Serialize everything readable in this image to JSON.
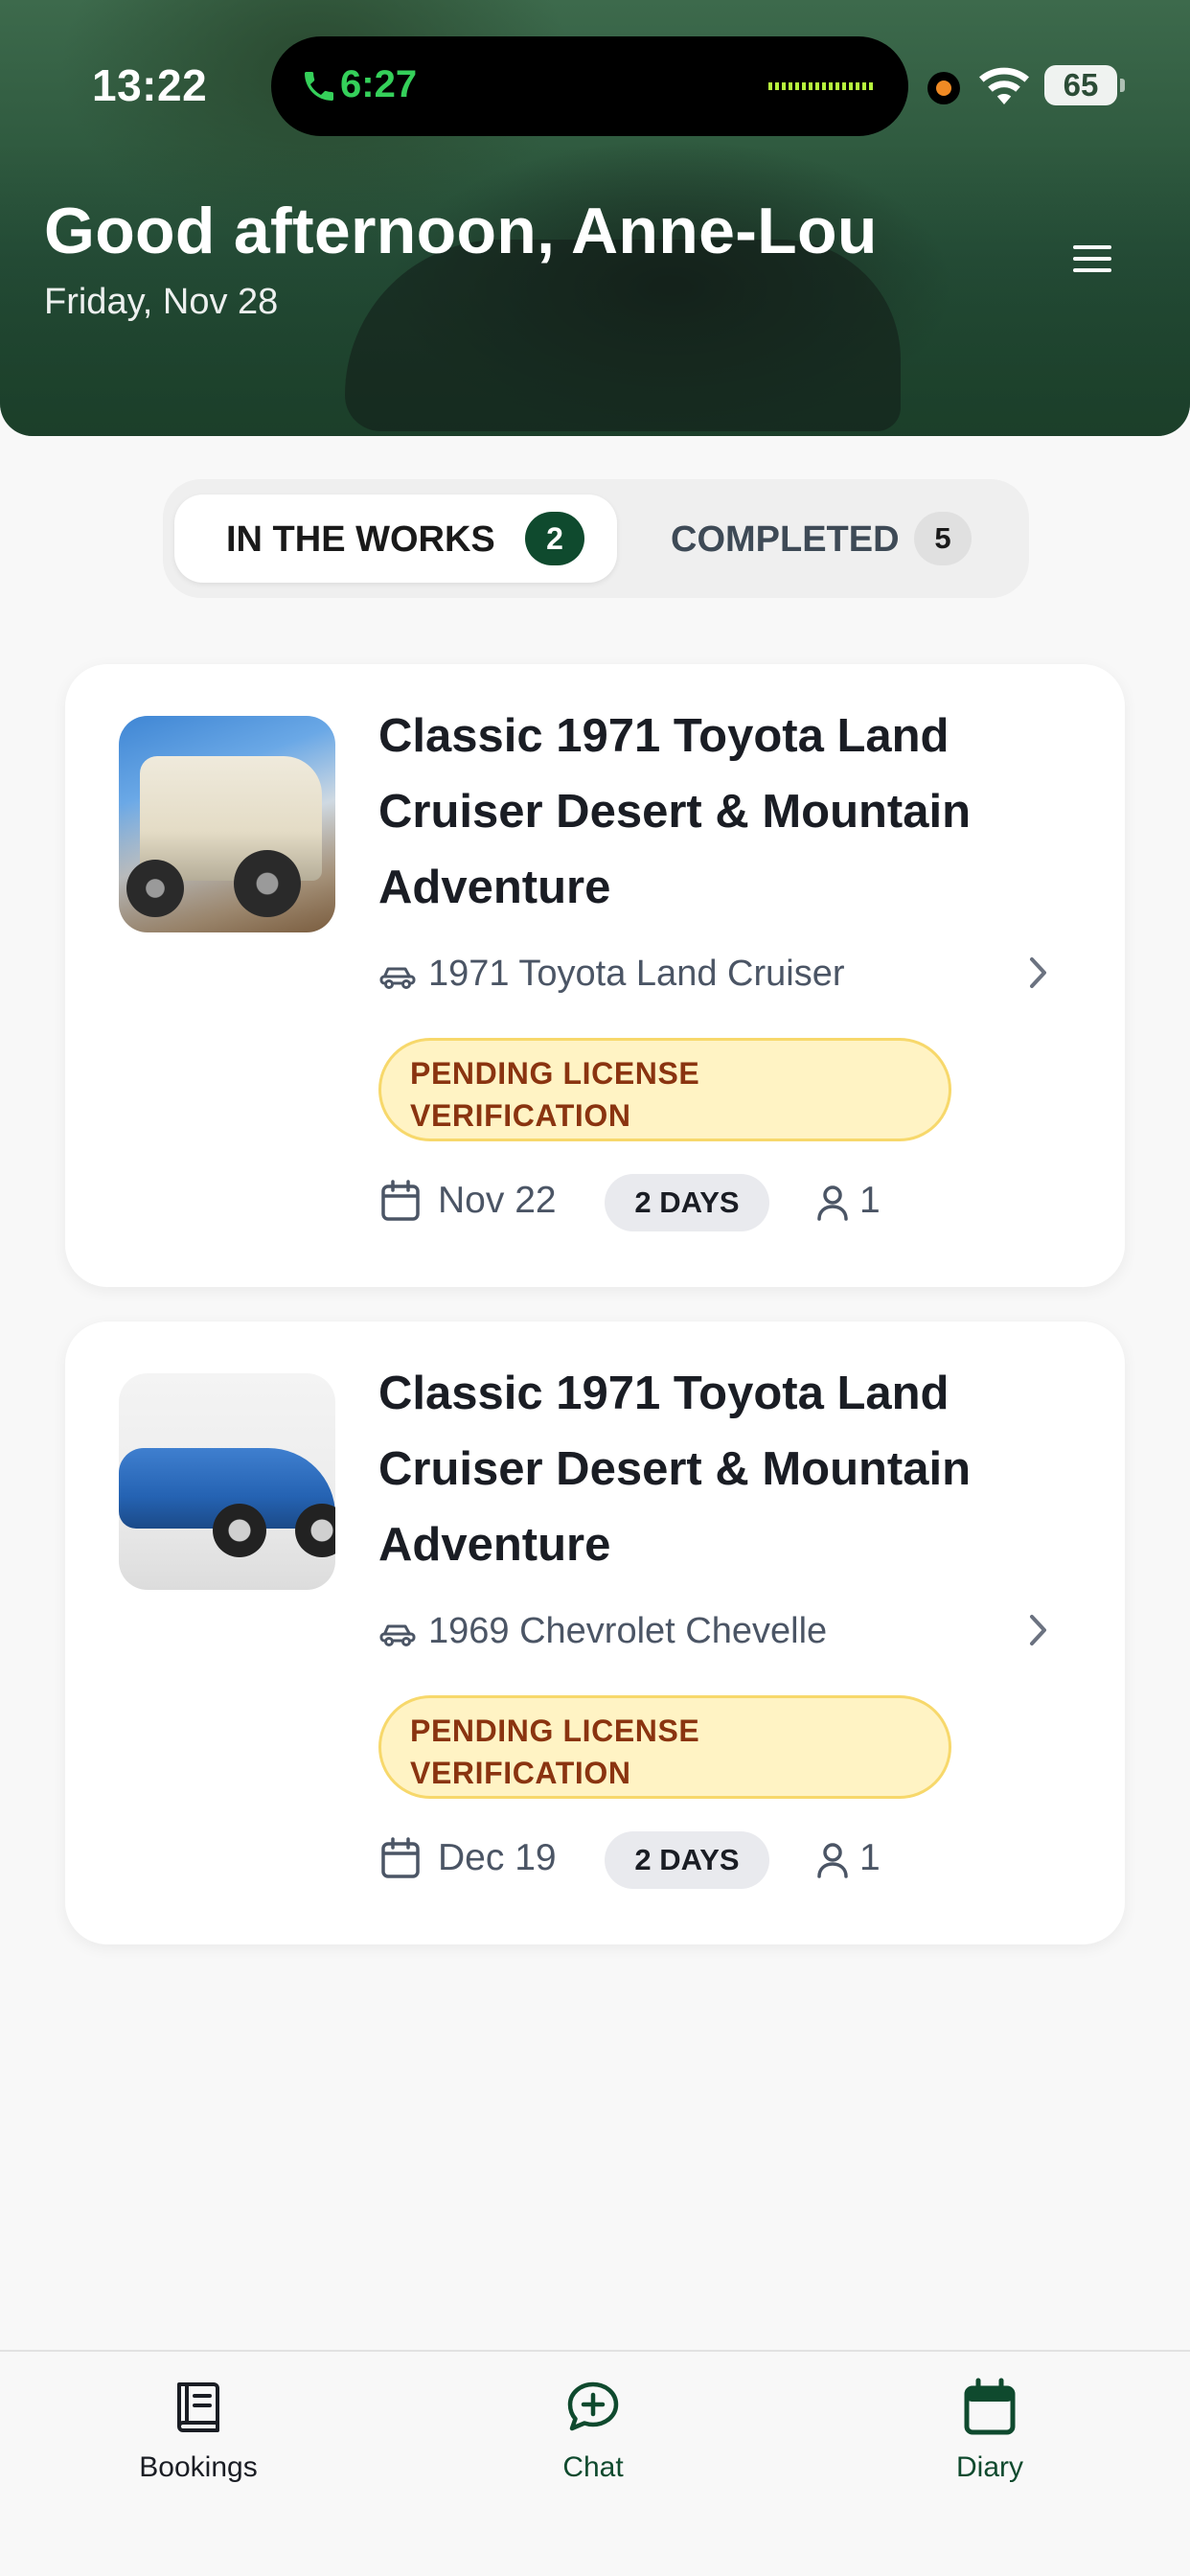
{
  "status_bar": {
    "time": "13:22",
    "call_time": "6:27",
    "battery": "65"
  },
  "header": {
    "greeting": "Good afternoon, Anne-Lou",
    "date": "Friday, Nov 28"
  },
  "tabs": [
    {
      "label": "IN THE WORKS",
      "count": "2",
      "active": true
    },
    {
      "label": "COMPLETED",
      "count": "5",
      "active": false
    }
  ],
  "bookings": [
    {
      "title": "Classic 1971 Toyota Land Cruiser Desert & Mountain Adventure",
      "vehicle": "1971 Toyota Land Cruiser",
      "status_line1": "PENDING LICENSE",
      "status_line2": "VERIFICATION",
      "date": "Nov 22",
      "duration": "2 DAYS",
      "guests": "1"
    },
    {
      "title": "Classic 1971 Toyota Land Cruiser Desert & Mountain Adventure",
      "vehicle": "1969 Chevrolet Chevelle",
      "status_line1": "PENDING LICENSE",
      "status_line2": "VERIFICATION",
      "date": "Dec 19",
      "duration": "2 DAYS",
      "guests": "1"
    }
  ],
  "bottom_nav": [
    {
      "label": "Bookings",
      "icon": "book-icon"
    },
    {
      "label": "Chat",
      "icon": "chat-plus-icon"
    },
    {
      "label": "Diary",
      "icon": "calendar-icon"
    }
  ],
  "colors": {
    "brand_green": "#0f4a2e",
    "pending_bg": "#fff3c4",
    "pending_text": "#8a3410"
  }
}
